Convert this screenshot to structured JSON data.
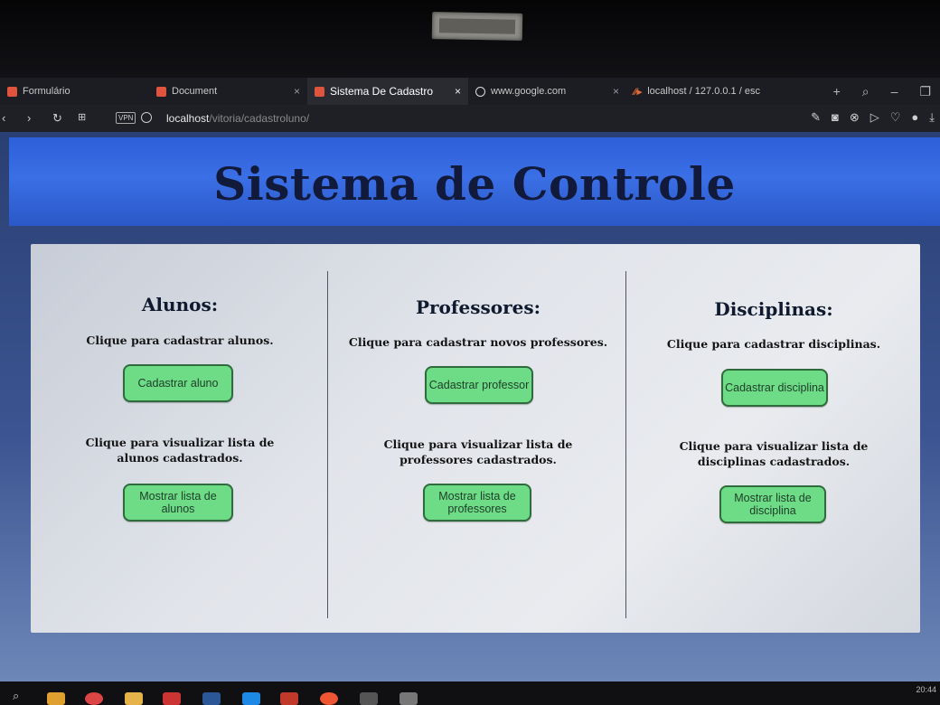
{
  "browser": {
    "tabs": [
      {
        "label": "Formulário",
        "active": false,
        "icon": "xampp-icon"
      },
      {
        "label": "Document",
        "active": false,
        "icon": "xampp-icon"
      },
      {
        "label": "Sistema De Cadastro",
        "active": true,
        "icon": "xampp-icon"
      },
      {
        "label": "www.google.com",
        "active": false,
        "icon": "globe-icon"
      },
      {
        "label": "localhost / 127.0.0.1 / esc",
        "active": false,
        "icon": "phpmyadmin-icon"
      }
    ],
    "new_tab": "+",
    "vpn_badge": "VPN",
    "url_host": "localhost",
    "url_path": "/vitoria/cadastroluno/"
  },
  "page": {
    "title": "Sistema de Controle",
    "columns": [
      {
        "heading": "Alunos:",
        "register_text": "Clique para cadastrar alunos.",
        "register_button": "Cadastrar aluno",
        "list_text": "Clique para visualizar lista de alunos cadastrados.",
        "list_button": "Mostrar lista de alunos"
      },
      {
        "heading": "Professores:",
        "register_text": "Clique para cadastrar novos professores.",
        "register_button": "Cadastrar professor",
        "list_text": "Clique para visualizar lista de professores cadastrados.",
        "list_button": "Mostrar lista de professores"
      },
      {
        "heading": "Disciplinas:",
        "register_text": "Clique para cadastrar disciplinas.",
        "register_button": "Cadastrar disciplina",
        "list_text": "Clique para visualizar lista de disciplinas cadastrados.",
        "list_button": "Mostrar lista de disciplina"
      }
    ]
  },
  "taskbar": {
    "clock": "20:44"
  },
  "colors": {
    "header_blue": "#3b6fe6",
    "title_navy": "#111a3a",
    "button_green": "#6edc86",
    "button_border": "#2f6b3c"
  }
}
